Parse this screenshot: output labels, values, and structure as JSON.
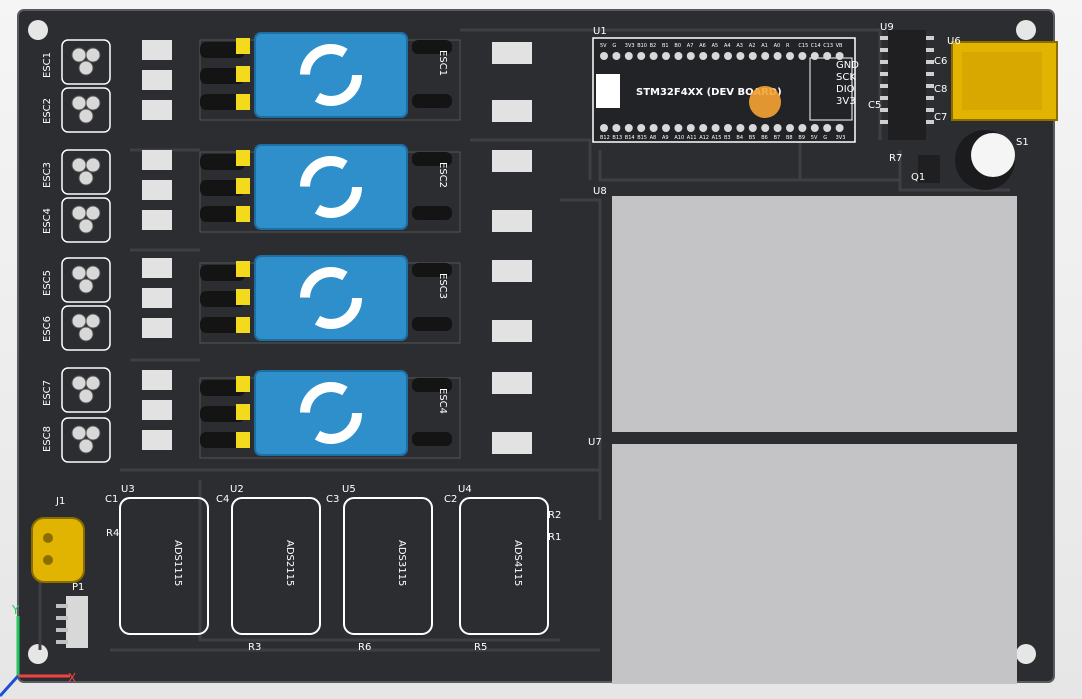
{
  "board": {
    "mcu_label": "STM32F4XX (DEV BOARD)",
    "top_pins": [
      "5V",
      "G",
      "3V3",
      "B10",
      "B2",
      "B1",
      "B0",
      "A7",
      "A6",
      "A5",
      "A4",
      "A3",
      "A2",
      "A1",
      "A0",
      "R",
      "C15",
      "C14",
      "C13",
      "VB"
    ],
    "bottom_pins": [
      "B12",
      "B13",
      "B14",
      "B15",
      "A8",
      "A9",
      "A10",
      "A11",
      "A12",
      "A15",
      "B3",
      "B4",
      "B5",
      "B6",
      "B7",
      "B8",
      "B9",
      "5V",
      "G",
      "3V3"
    ],
    "debug_pins": [
      "GND",
      "SCK",
      "DIO",
      "3V3"
    ],
    "esc_modules": [
      "ESC1",
      "ESC2",
      "ESC3",
      "ESC4"
    ],
    "esc_labels": [
      "ESC1",
      "ESC2",
      "ESC3",
      "ESC4",
      "ESC5",
      "ESC6",
      "ESC7",
      "ESC8"
    ],
    "adc_chips": [
      {
        "ref": "U3",
        "part": "ADS1115",
        "cap": "C1",
        "res": "R3"
      },
      {
        "ref": "U2",
        "part": "ADS2115",
        "cap": "C4",
        "res": "R6"
      },
      {
        "ref": "U5",
        "part": "ADS3115",
        "cap": "C3",
        "res": "R5"
      },
      {
        "ref": "U4",
        "part": "ADS4115",
        "cap": "C2",
        "res": "R1"
      }
    ],
    "refs": {
      "u1": "U1",
      "u6": "U6",
      "u7": "U7",
      "u8": "U8",
      "u9": "U9",
      "j1": "J1",
      "p1": "P1",
      "q1": "Q1",
      "s1": "S1",
      "r2": "R2",
      "r1": "R1",
      "r4": "R4",
      "r7": "R7",
      "c5": "C5",
      "c6": "C6",
      "c7": "C7",
      "c8": "C8"
    },
    "axis": {
      "x": "X",
      "y": "Y"
    }
  },
  "colors": {
    "board": "#2c2d31",
    "trace": "#3d3f44",
    "silk": "#ffffff",
    "pad": "#c8c8c8",
    "esc_blue": "#2e8fcb",
    "gold": "#f3da1c",
    "heatsink": "#c4c4c6"
  }
}
